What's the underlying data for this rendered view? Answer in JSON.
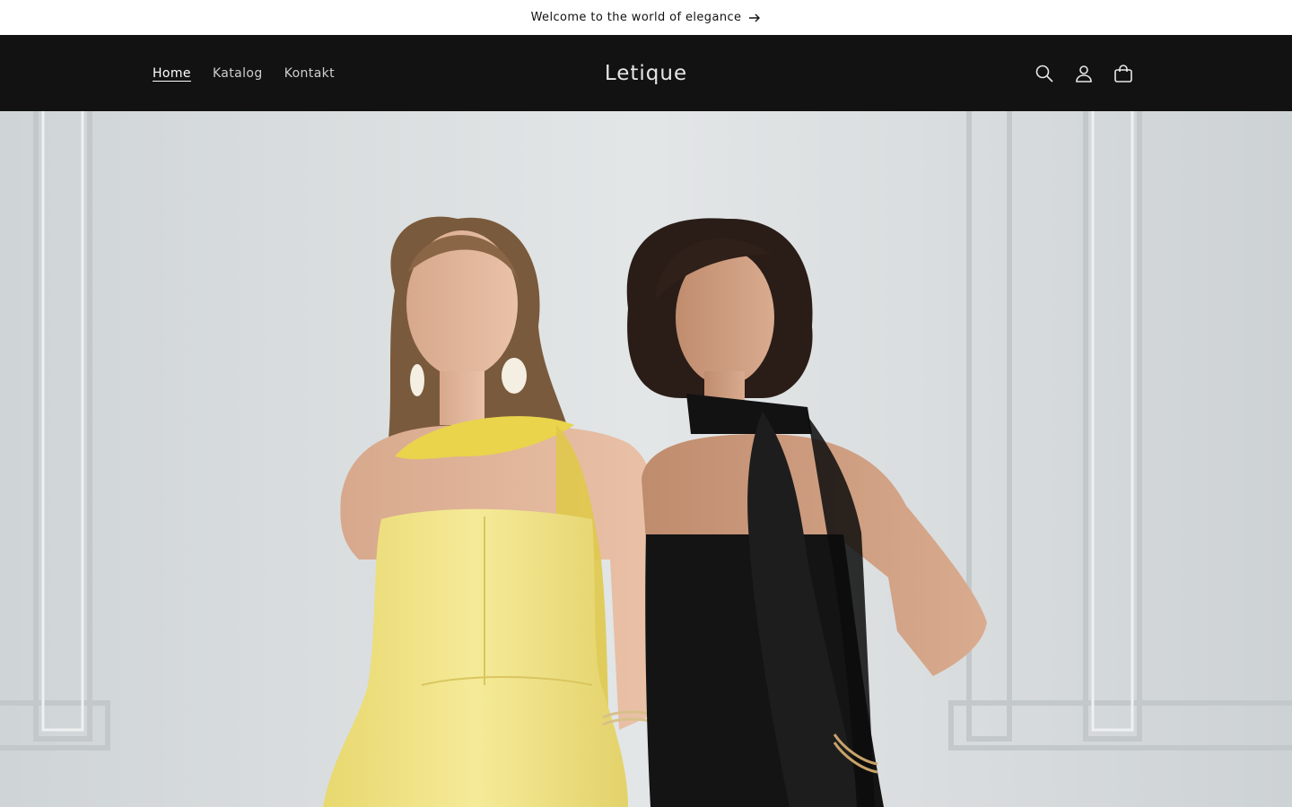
{
  "announcement": {
    "text": "Welcome to the world of elegance",
    "arrow_icon": "arrow-right-icon"
  },
  "header": {
    "logo": "Letique",
    "nav": [
      {
        "label": "Home",
        "active": true
      },
      {
        "label": "Katalog",
        "active": false
      },
      {
        "label": "Kontakt",
        "active": false
      }
    ],
    "icons": [
      "search-icon",
      "account-icon",
      "cart-icon"
    ]
  },
  "hero": {
    "image_description_icon": "hero-banner-image"
  },
  "colors": {
    "header_bg": "#121212",
    "announcement_bg": "#ffffff",
    "hero_wall": "#dcdfe0",
    "yellow_dress": "#f2e48a",
    "black_dress": "#141414"
  }
}
